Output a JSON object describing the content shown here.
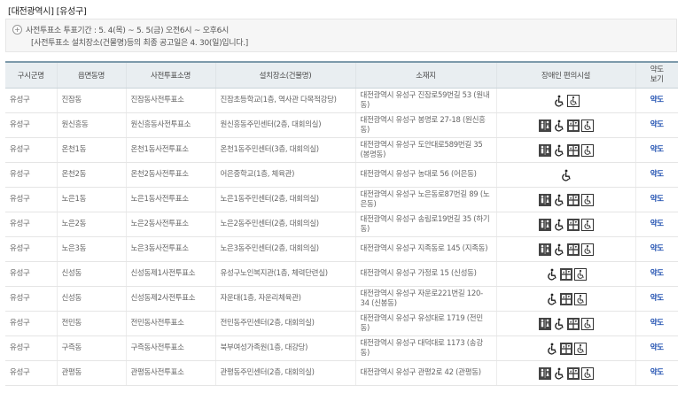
{
  "header": {
    "region": "[대전광역시] [유성구]"
  },
  "notice": {
    "line1": "사전투표소 투표기간 : 5. 4(목) ~ 5. 5(금) 오전6시 ~ 오후6시",
    "line2": "[사전투표소 설치장소(건물명)등의 최종 공고일은 4. 30(일)입니다.]"
  },
  "table": {
    "headers": [
      "구시군명",
      "읍면동명",
      "사전투표소명",
      "설치장소(건물명)",
      "소재지",
      "장애인 편의시설",
      "약도\n보기"
    ],
    "rows": [
      {
        "gu": "유성구",
        "dong": "진잠동",
        "name": "진잠동사전투표소",
        "place": "진잠초등학교(1층, 역사관 다목적강당)",
        "addr": "대전광역시 유성구 진잠로59번길 53 (원내동)",
        "icons": [
          "wheelchair-icon",
          "wheelchair-box-icon"
        ],
        "map": "약도"
      },
      {
        "gu": "유성구",
        "dong": "원신흥동",
        "name": "원신흥동사전투표소",
        "place": "원신흥동주민센터(2층, 대회의실)",
        "addr": "대전광역시 유성구 봉명로 27-18 (원신흥동)",
        "icons": [
          "restroom-icon",
          "wheelchair-icon",
          "elevator-icon",
          "wheelchair-box-icon"
        ],
        "map": "약도"
      },
      {
        "gu": "유성구",
        "dong": "온천1동",
        "name": "온천1동사전투표소",
        "place": "온천1동주민센터(3층, 대회의실)",
        "addr": "대전광역시 유성구 도안대로589번길 35 (봉명동)",
        "icons": [
          "restroom-icon",
          "wheelchair-icon",
          "elevator-icon",
          "wheelchair-box-icon"
        ],
        "map": "약도"
      },
      {
        "gu": "유성구",
        "dong": "온천2동",
        "name": "온천2동사전투표소",
        "place": "어은중학교(1층, 체육관)",
        "addr": "대전광역시 유성구 농대로 56 (어은동)",
        "icons": [
          "wheelchair-icon"
        ],
        "map": "약도"
      },
      {
        "gu": "유성구",
        "dong": "노은1동",
        "name": "노은1동사전투표소",
        "place": "노은1동주민센터(2층, 대회의실)",
        "addr": "대전광역시 유성구 노은동로87번길 89 (노은동)",
        "icons": [
          "restroom-icon",
          "wheelchair-icon",
          "elevator-icon",
          "wheelchair-box-icon"
        ],
        "map": "약도"
      },
      {
        "gu": "유성구",
        "dong": "노은2동",
        "name": "노은2동사전투표소",
        "place": "노은2동주민센터(2층, 대회의실)",
        "addr": "대전광역시 유성구 송림로19번길 35 (하기동)",
        "icons": [
          "restroom-icon",
          "wheelchair-icon",
          "elevator-icon",
          "wheelchair-box-icon"
        ],
        "map": "약도"
      },
      {
        "gu": "유성구",
        "dong": "노은3동",
        "name": "노은3동사전투표소",
        "place": "노은3동주민센터(2층, 대회의실)",
        "addr": "대전광역시 유성구 지족동로 145 (지족동)",
        "icons": [
          "restroom-icon",
          "wheelchair-icon",
          "elevator-icon",
          "wheelchair-box-icon"
        ],
        "map": "약도"
      },
      {
        "gu": "유성구",
        "dong": "신성동",
        "name": "신성동제1사전투표소",
        "place": "유성구노인복지관(1층, 체력단련실)",
        "addr": "대전광역시 유성구 가정로 15 (신성동)",
        "icons": [
          "wheelchair-icon",
          "elevator-icon",
          "wheelchair-box-icon"
        ],
        "map": "약도"
      },
      {
        "gu": "유성구",
        "dong": "신성동",
        "name": "신성동제2사전투표소",
        "place": "자운대(1층, 자운리체육관)",
        "addr": "대전광역시 유성구 자운로221번길 120-34 (신봉동)",
        "icons": [
          "wheelchair-icon",
          "elevator-icon",
          "wheelchair-box-icon"
        ],
        "map": "약도"
      },
      {
        "gu": "유성구",
        "dong": "전민동",
        "name": "전민동사전투표소",
        "place": "전민동주민센터(2층, 대회의실)",
        "addr": "대전광역시 유성구 유성대로 1719 (전민동)",
        "icons": [
          "restroom-icon",
          "wheelchair-icon",
          "elevator-icon",
          "wheelchair-box-icon"
        ],
        "map": "약도"
      },
      {
        "gu": "유성구",
        "dong": "구즉동",
        "name": "구즉동사전투표소",
        "place": "북부여성가족원(1층, 대강당)",
        "addr": "대전광역시 유성구 대덕대로 1173 (송강동)",
        "icons": [
          "wheelchair-icon",
          "elevator-icon",
          "wheelchair-box-icon"
        ],
        "map": "약도"
      },
      {
        "gu": "유성구",
        "dong": "관평동",
        "name": "관평동사전투표소",
        "place": "관평동주민센터(2층, 대회의실)",
        "addr": "대전광역시 유성구 관평2로 42 (관평동)",
        "icons": [
          "restroom-icon",
          "wheelchair-icon",
          "elevator-icon",
          "wheelchair-box-icon"
        ],
        "map": "약도"
      }
    ]
  }
}
